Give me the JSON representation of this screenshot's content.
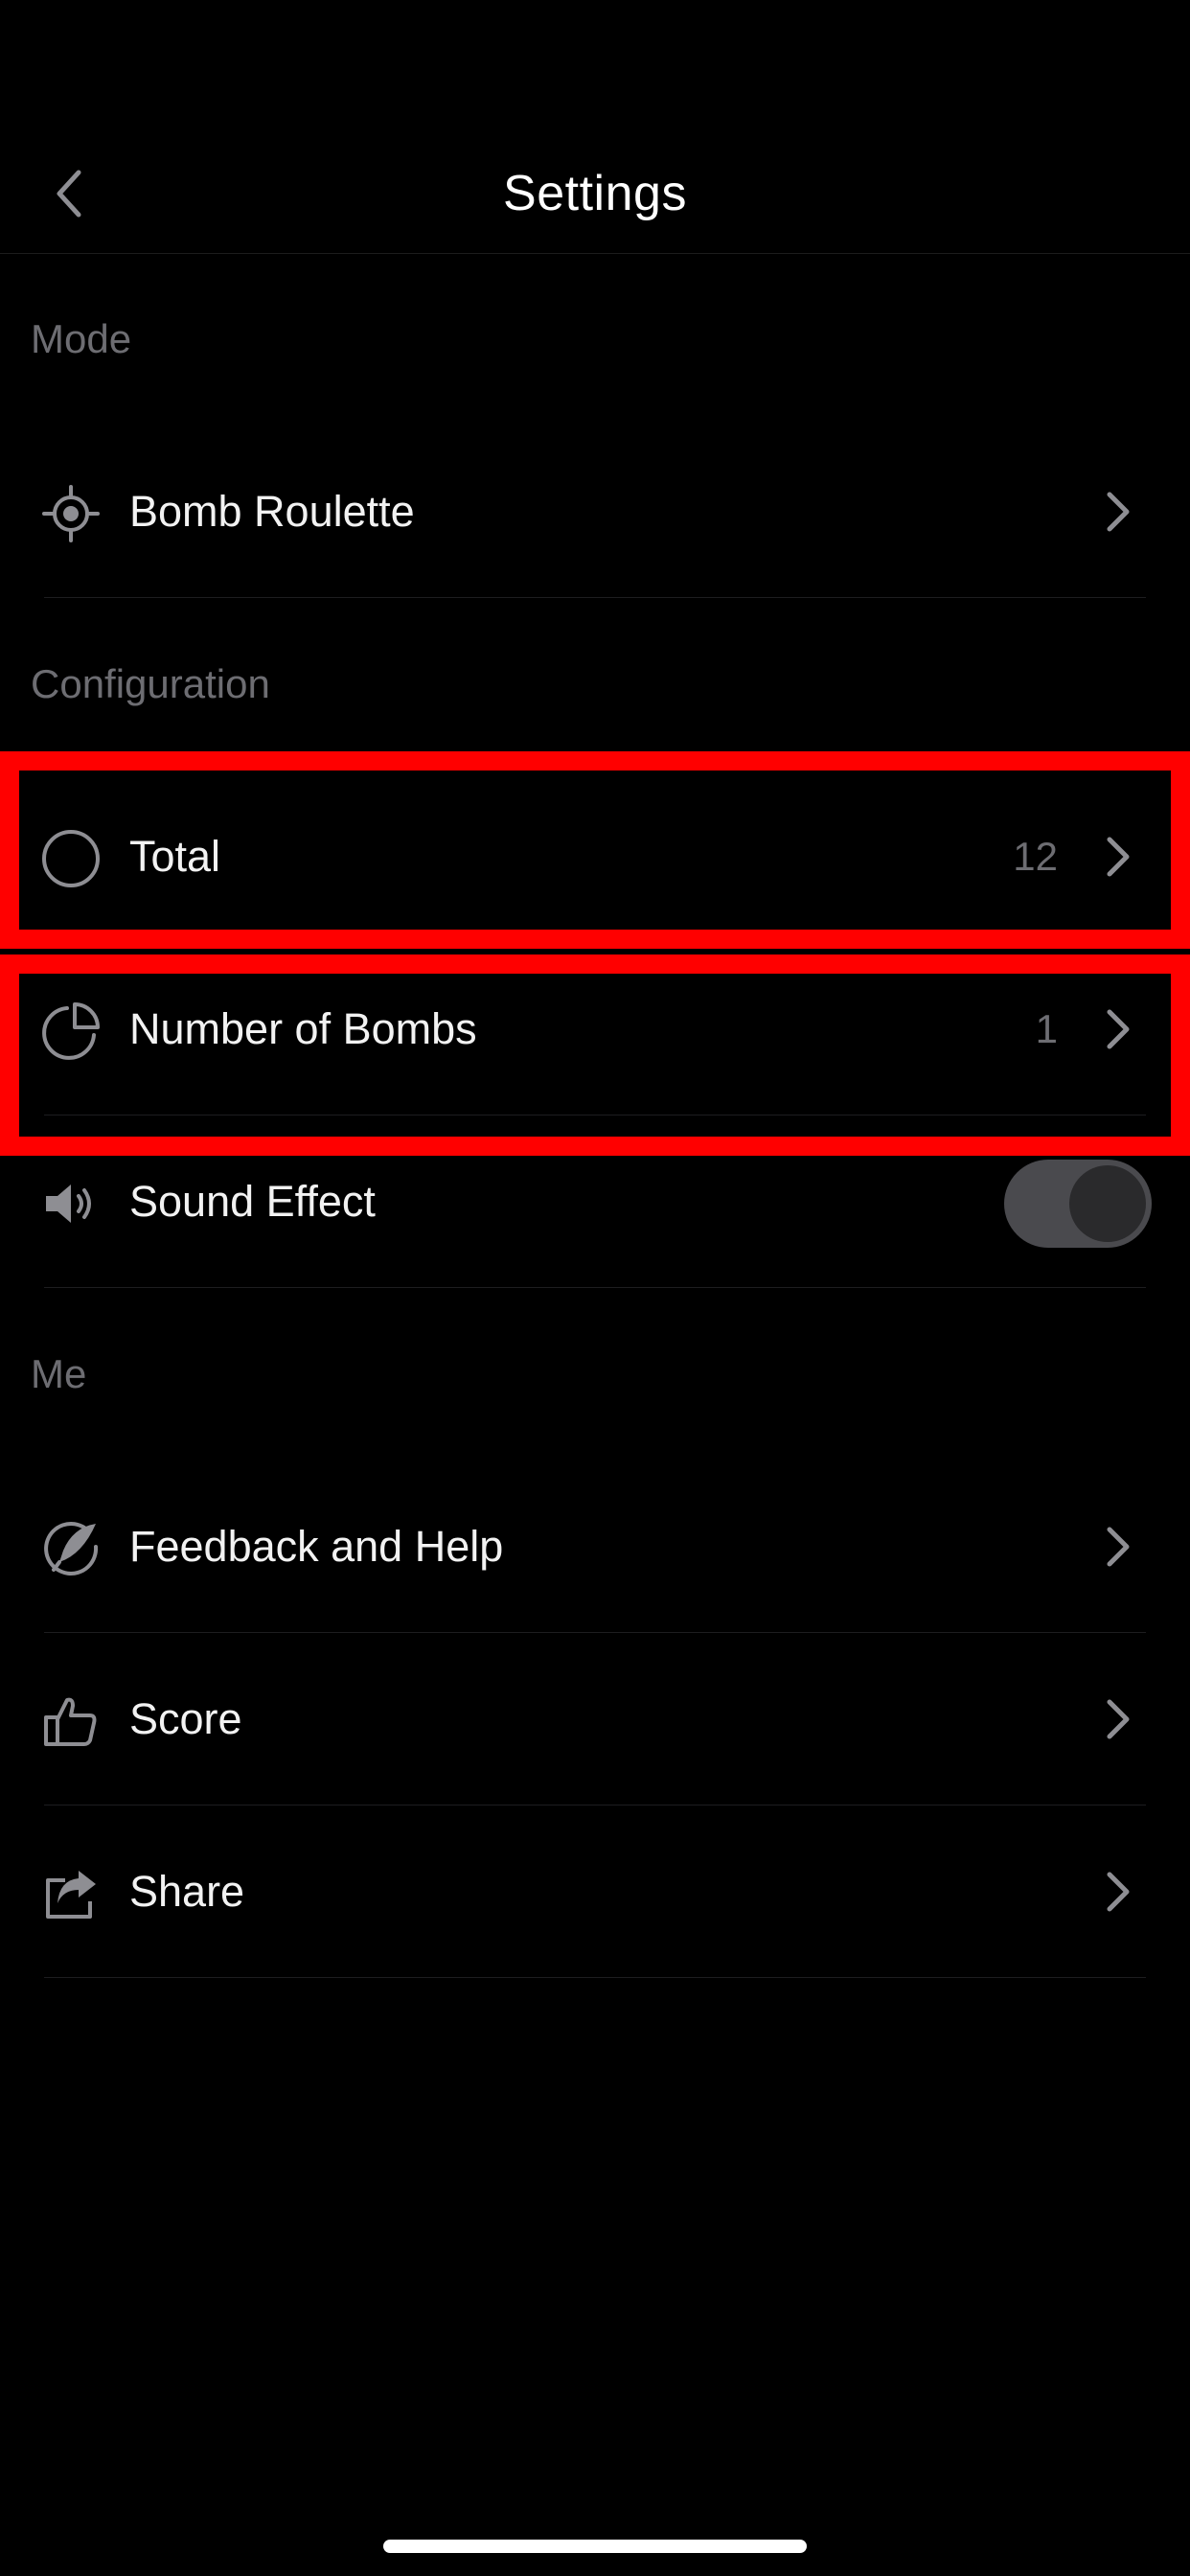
{
  "header": {
    "title": "Settings",
    "back_icon": "chevron-left-icon"
  },
  "sections": {
    "mode": {
      "title": "Mode",
      "items": [
        {
          "label": "Bomb Roulette",
          "icon": "target-icon"
        }
      ]
    },
    "configuration": {
      "title": "Configuration",
      "items": [
        {
          "label": "Total",
          "value": "12",
          "icon": "circle-icon"
        },
        {
          "label": "Number of Bombs",
          "value": "1",
          "icon": "pie-chart-icon"
        },
        {
          "label": "Sound Effect",
          "icon": "speaker-icon",
          "toggle_state": "off"
        }
      ]
    },
    "me": {
      "title": "Me",
      "items": [
        {
          "label": "Feedback and Help",
          "icon": "feather-pen-icon"
        },
        {
          "label": "Score",
          "icon": "thumbs-up-icon"
        },
        {
          "label": "Share",
          "icon": "share-icon"
        }
      ]
    }
  },
  "colors": {
    "background": "#000000",
    "primary_text": "#f2f2f2",
    "secondary_text": "#6d6d72",
    "icon_gray": "#8e8e93",
    "highlight": "#ff0000",
    "toggle_track": "#4a4a4e"
  }
}
